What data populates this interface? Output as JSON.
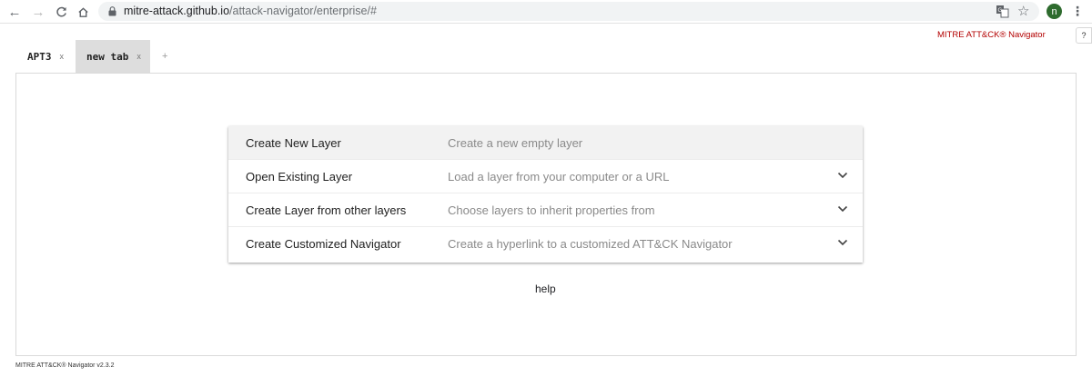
{
  "browser": {
    "url_host": "mitre-attack.github.io",
    "url_path": "/attack-navigator/enterprise/#",
    "avatar_letter": "n"
  },
  "app": {
    "brand": "MITRE ATT&CK® Navigator",
    "help_button": "?",
    "version_footer": "MITRE ATT&CK® Navigator v2.3.2"
  },
  "tabs": [
    {
      "label": "APT3",
      "close": "x"
    },
    {
      "label": "new tab",
      "close": "x"
    }
  ],
  "add_tab": "+",
  "panel": {
    "rows": [
      {
        "title": "Create New Layer",
        "description": "Create a new empty layer"
      },
      {
        "title": "Open Existing Layer",
        "description": "Load a layer from your computer or a URL"
      },
      {
        "title": "Create Layer from other layers",
        "description": "Choose layers to inherit properties from"
      },
      {
        "title": "Create Customized Navigator",
        "description": "Create a hyperlink to a customized ATT&CK Navigator"
      }
    ]
  },
  "help_link": "help",
  "colors": {
    "brand": "#b30000",
    "active_tab": "#dddddd",
    "first_row": "#f2f2f2"
  },
  "icons": [
    "back-arrow-icon",
    "forward-arrow-icon",
    "reload-icon",
    "home-icon",
    "lock-icon",
    "translate-icon",
    "star-icon",
    "more-vert-icon",
    "chevron-down-icon"
  ]
}
